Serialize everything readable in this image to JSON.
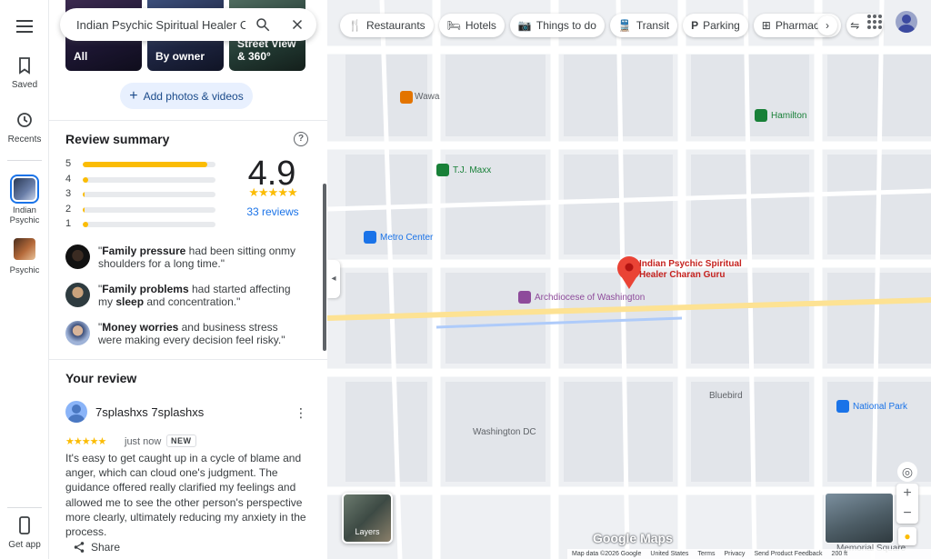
{
  "search": {
    "value": "Indian Psychic Spiritual Healer Char"
  },
  "rail": {
    "saved": "Saved",
    "recents": "Recents",
    "item1": "Indian Psychic",
    "item2": "Psychic",
    "get_app": "Get app"
  },
  "photos": [
    {
      "label": "All"
    },
    {
      "label": "By owner"
    },
    {
      "label": "Street View & 360°"
    }
  ],
  "add_photos": "Add photos & videos",
  "review_summary": {
    "title": "Review summary",
    "rating": "4.9",
    "stars": "★★★★★",
    "reviews_link": "33 reviews",
    "distribution": [
      {
        "stars": "5",
        "fraction": 0.94
      },
      {
        "stars": "4",
        "fraction": 0.02
      },
      {
        "stars": "3",
        "fraction": 0.0
      },
      {
        "stars": "2",
        "fraction": 0.0
      },
      {
        "stars": "1",
        "fraction": 0.04
      }
    ],
    "snippets": [
      {
        "bold": "Family pressure",
        "rest": " had been sitting onmy shoulders for a long time.\""
      },
      {
        "bold": "Family problems",
        "rest": " had started affecting my ",
        "bold2": "sleep",
        "rest2": " and concentration.\""
      },
      {
        "bold": "Money worries",
        "rest": " and business stress were making every decision feel risky.\""
      }
    ]
  },
  "your_review": {
    "title": "Your review",
    "user": "7splashxs 7splashxs",
    "stars": "★★★★★",
    "time": "just now",
    "badge": "NEW",
    "text": "It's easy to get caught up in a cycle of blame and anger, which can cloud one's judgment. The guidance offered really clarified my feelings and allowed me to see the other person's perspective more clearly, ultimately reducing my anxiety in the process.",
    "share": "Share"
  },
  "chips": [
    "Restaurants",
    "Hotels",
    "Things to do",
    "Transit",
    "Parking",
    "Pharmacies"
  ],
  "map": {
    "pin_label": "Indian Psychic Spiritual Healer Charan Guru",
    "pois": {
      "wawa": "Wawa",
      "metro": "Metro Center",
      "tjmaxx": "T.J. Maxx",
      "catholic": "Archdiocese of Washington",
      "hamilton": "Hamilton",
      "bluebird": "Bluebird",
      "nationalpark": "National Park",
      "washington": "Washington DC",
      "memorial": "Memorial Square"
    },
    "layers": "Layers",
    "logo": "Google Maps",
    "attribution": [
      "Map data ©2026 Google",
      "United States",
      "Terms",
      "Privacy",
      "Send Product Feedback",
      "200 ft"
    ]
  }
}
